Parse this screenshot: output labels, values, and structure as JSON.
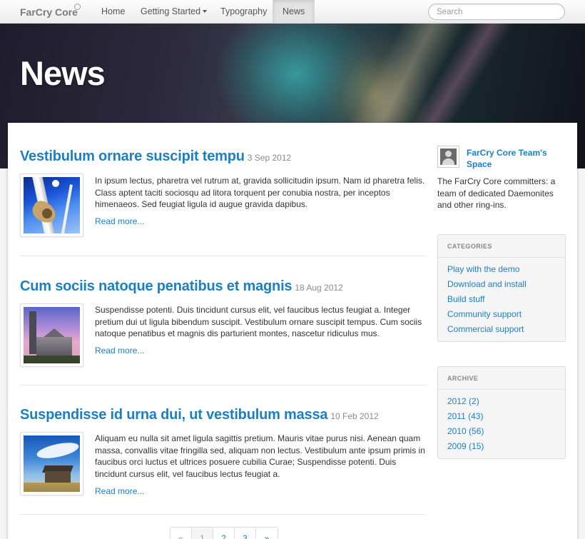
{
  "navbar": {
    "brand": "FarCry Core",
    "items": [
      {
        "label": "Home"
      },
      {
        "label": "Getting Started"
      },
      {
        "label": "Typography"
      },
      {
        "label": "News"
      }
    ],
    "search_placeholder": "Search"
  },
  "hero": {
    "title": "News"
  },
  "posts": [
    {
      "title": "Vestibulum ornare suscipit tempu",
      "date": "3 Sep 2012",
      "excerpt": "In ipsum lectus, pharetra vel rutrum at, gravida sollicitudin ipsum. Nam id pharetra felis. Class aptent taciti sociosqu ad litora torquent per conubia nostra, per inceptos himenaeos. Sed feugiat ligula id augue gravida dapibus.",
      "read_more": "Read more..."
    },
    {
      "title": "Cum sociis natoque penatibus et magnis",
      "date": "18 Aug 2012",
      "excerpt": "Suspendisse potenti. Duis tincidunt cursus elit, vel faucibus lectus feugiat a. Integer pretium dui ut ligula bibendum suscipit. Vestibulum ornare suscipit tempus. Cum sociis natoque penatibus et magnis dis parturient montes, nascetur ridiculus mus.",
      "read_more": "Read more..."
    },
    {
      "title": "Suspendisse id urna dui, ut vestibulum massa",
      "date": "10 Feb 2012",
      "excerpt": "Aliquam eu nulla sit amet ligula sagittis pretium. Mauris vitae purus nisi. Aenean quam massa, convallis vitae fringilla sed, aliquam non lectus. Vestibulum ante ipsum primis in faucibus orci luctus et ultrices posuere cubilia Curae; Suspendisse potenti. Duis tincidunt cursus elit, vel faucibus lectus feugiat a.",
      "read_more": "Read more..."
    }
  ],
  "pagination": {
    "prev": "«",
    "pages": [
      "1",
      "2",
      "3"
    ],
    "next": "»",
    "current": "1"
  },
  "sidebar": {
    "author": {
      "name": "FarCry Core Team's Space",
      "description": "The FarCry Core committers: a team of dedicated Daemonites and other ring-ins."
    },
    "categories": {
      "title": "CATEGORIES",
      "items": [
        "Play with the demo",
        "Download and install",
        "Build stuff",
        "Community support",
        "Commercial support"
      ]
    },
    "archive": {
      "title": "ARCHIVE",
      "items": [
        "2012 (2)",
        "2011 (43)",
        "2010 (56)",
        "2009 (15)"
      ]
    }
  },
  "colors": {
    "link": "#1b7fc3",
    "date": "#8a8a8a"
  }
}
